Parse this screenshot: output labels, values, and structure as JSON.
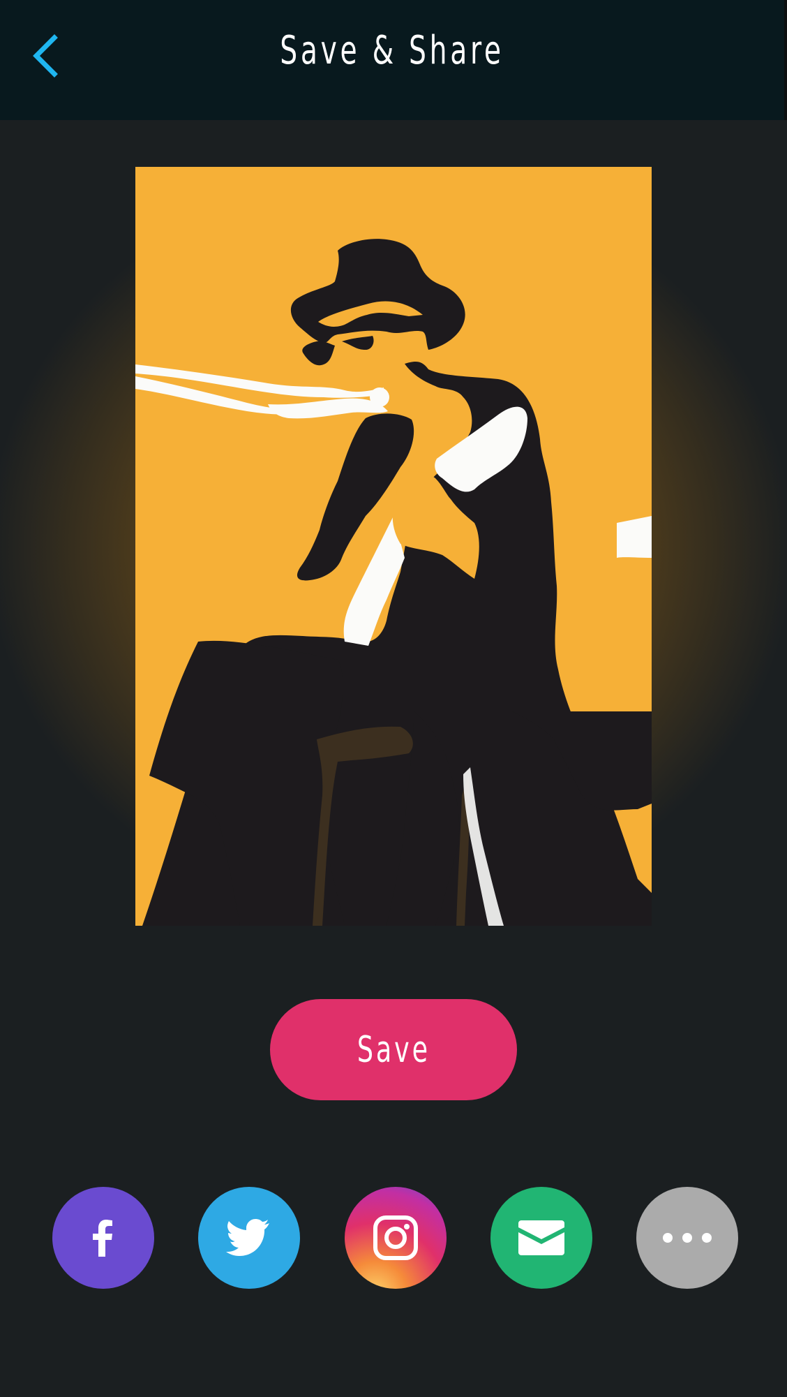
{
  "header": {
    "title": "Save & Share",
    "back_icon": "chevron-left-icon",
    "accent": "#1fb6f0",
    "background": "#08191e"
  },
  "artwork": {
    "background_color": "#f6b037",
    "figure_color": "#1d1a1d",
    "highlight_color": "#fbfbf9"
  },
  "actions": {
    "save_label": "Save",
    "save_color": "#e0306a"
  },
  "share": [
    {
      "name": "facebook",
      "icon": "facebook-icon",
      "color": "#6a4bd0"
    },
    {
      "name": "twitter",
      "icon": "twitter-icon",
      "color": "#2ea9e4"
    },
    {
      "name": "instagram",
      "icon": "instagram-icon",
      "color": "#d6316f"
    },
    {
      "name": "email",
      "icon": "email-icon",
      "color": "#21b573"
    },
    {
      "name": "more",
      "icon": "more-icon",
      "color": "#ababab"
    }
  ]
}
